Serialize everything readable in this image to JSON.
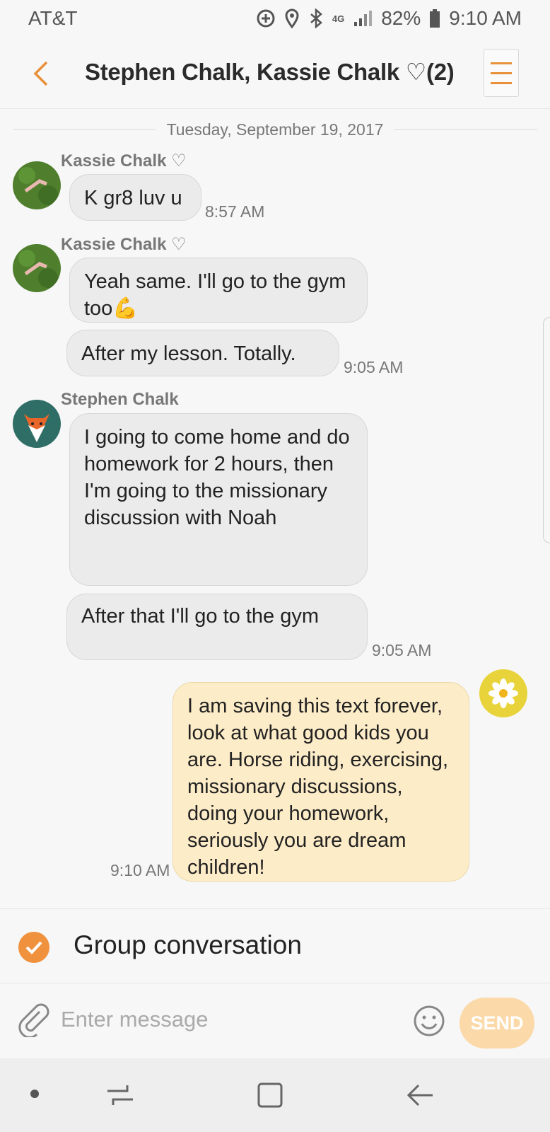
{
  "status_bar": {
    "carrier": "AT&T",
    "network": "4G LTE",
    "battery": "82%",
    "time": "9:10 AM",
    "icons": [
      "data-saver-icon",
      "location-icon",
      "bluetooth-icon",
      "lte-icon",
      "signal-icon",
      "battery-icon"
    ]
  },
  "header": {
    "title": "Stephen Chalk, Kassie Chalk ♡(2)",
    "back_icon": "chevron-left-icon",
    "menu_icon": "menu-icon"
  },
  "date_divider": "Tuesday, September 19, 2017",
  "messages": [
    {
      "sender": "Kassie Chalk ♡",
      "text": "K gr8 luv u",
      "time": "8:57 AM"
    },
    {
      "sender": "Kassie Chalk ♡",
      "text": "Yeah same. I'll go to the gym too💪",
      "time": ""
    },
    {
      "sender": "",
      "text": "After my lesson. Totally.",
      "time": "9:05 AM"
    },
    {
      "sender": "Stephen Chalk",
      "text": "I going to come home and do homework for 2 hours, then I'm going to the missionary discussion with Noah",
      "time": ""
    },
    {
      "sender": "",
      "text": "After that I'll go to the gym",
      "time": "9:05 AM"
    },
    {
      "sender": "",
      "text": "I am saving this text forever, look at what good kids you are. Horse riding, exercising, missionary discussions, doing your homework, seriously you are dream children!",
      "time": "9:10 AM"
    }
  ],
  "group_conversation": {
    "label": "Group conversation",
    "checked": true
  },
  "composer": {
    "placeholder": "Enter message",
    "send_label": "SEND"
  },
  "colors": {
    "accent": "#e8913a",
    "outgoing_bubble": "#fdecc8",
    "incoming_bubble": "#ebebeb"
  }
}
